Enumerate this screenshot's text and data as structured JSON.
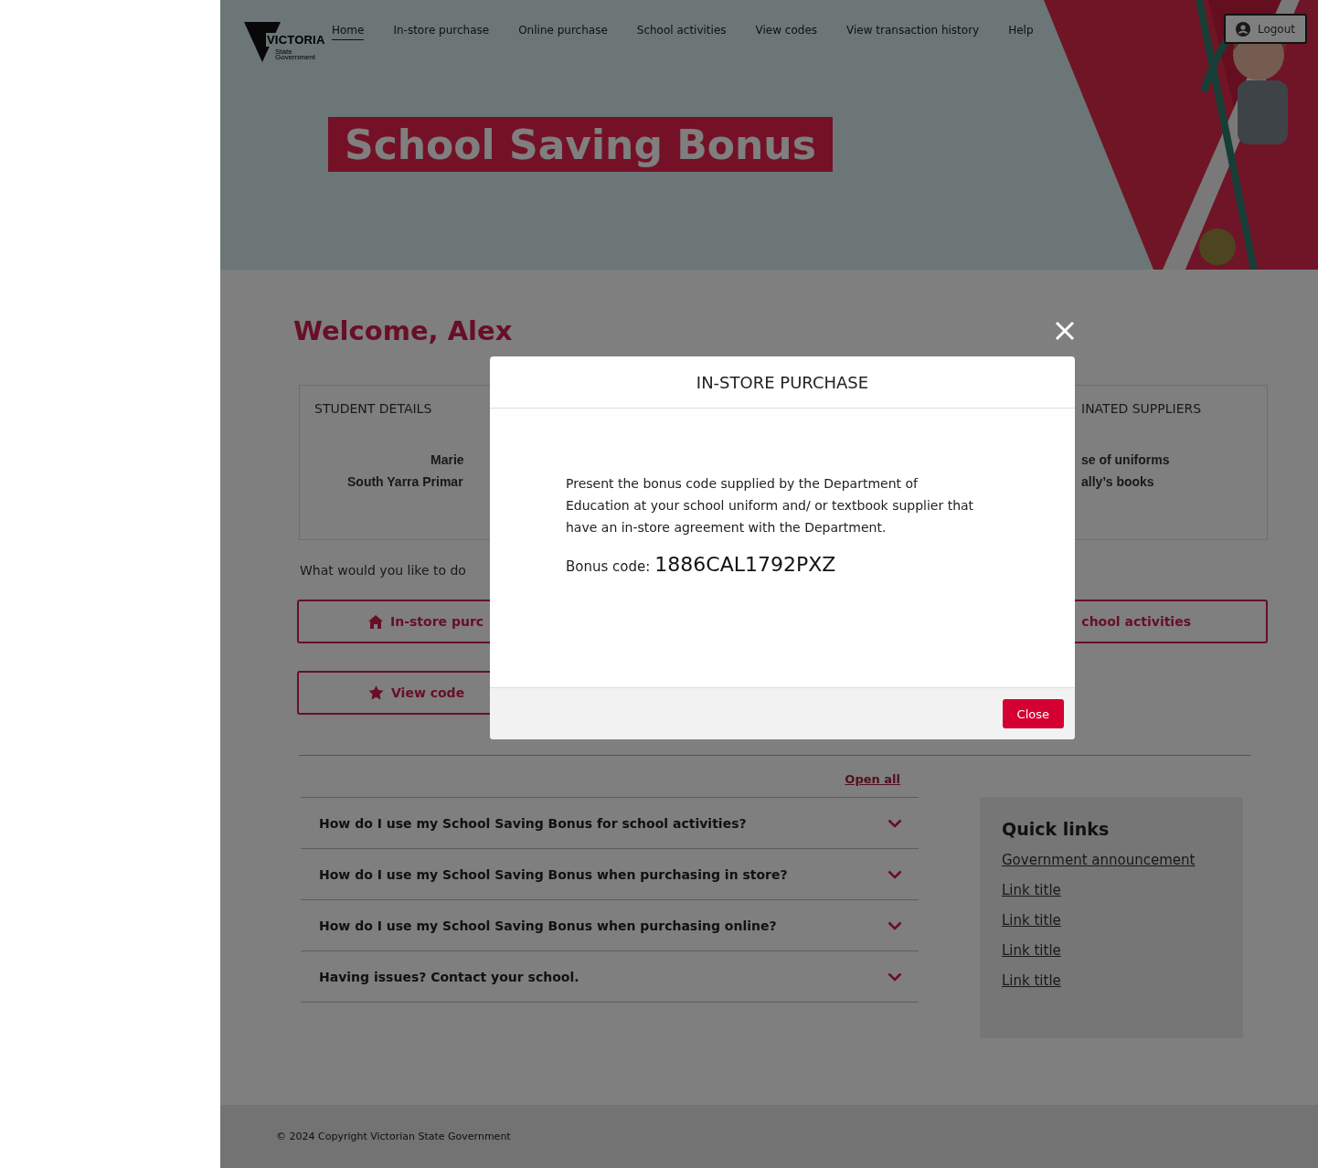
{
  "nav": {
    "logo": {
      "name": "VICTORIA",
      "line_1": "State",
      "line_2": "Government"
    },
    "items": [
      {
        "label": "Home",
        "selected": true
      },
      {
        "label": "In-store purchase",
        "selected": false
      },
      {
        "label": "Online purchase",
        "selected": false
      },
      {
        "label": "School activities",
        "selected": false
      },
      {
        "label": "View codes",
        "selected": false
      },
      {
        "label": "View transaction history",
        "selected": false
      },
      {
        "label": "Help",
        "selected": false
      }
    ],
    "logout": "Logout"
  },
  "hero": {
    "title": "School Saving Bonus"
  },
  "welcome": "Welcome, Alex",
  "cards": [
    {
      "title": "STUDENT DETAILS",
      "lines": [
        "Marie",
        "South Yarra Primar"
      ]
    },
    {
      "title": "INATED SUPPLIERS",
      "lines": [
        "se of uniforms",
        "ally’s books"
      ]
    }
  ],
  "prompt": "What would you like to do",
  "actions": [
    {
      "label": "In-store purc"
    },
    {
      "label": "chool activities"
    },
    {
      "label": "View code"
    }
  ],
  "faq": {
    "open_all": "Open all",
    "items": [
      {
        "question": "How do I use my School Saving Bonus for school activities?",
        "expanded": false
      },
      {
        "question": "How do I use my School Saving Bonus when purchasing in store?",
        "expanded": false
      },
      {
        "question": "How do I use my School Saving Bonus when purchasing online?",
        "expanded": false
      },
      {
        "question": "Having issues? Contact your school.",
        "expanded": false
      }
    ]
  },
  "quick_links": {
    "title": "Quick links",
    "links": [
      "Government announcement",
      "Link title",
      "Link title",
      "Link title",
      "Link title"
    ]
  },
  "footer": "© 2024 Copyright Victorian State Government",
  "modal": {
    "title": "IN-STORE PURCHASE",
    "body": "Present the bonus code supplied by the Department of Education at your school uniform and/ or textbook supplier that have an in-store agreement with the Department.",
    "code_label": "Bonus code:",
    "code": "1886CAL1792PXZ",
    "close": "Close"
  }
}
